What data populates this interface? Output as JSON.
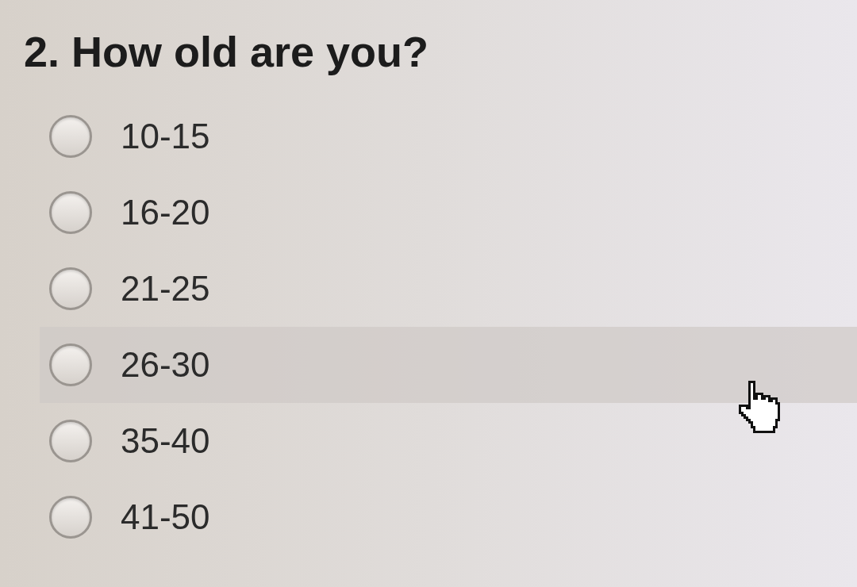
{
  "question": {
    "title": "2. How old are you?",
    "options": [
      {
        "label": "10-15",
        "selected": false,
        "hovered": false
      },
      {
        "label": "16-20",
        "selected": false,
        "hovered": false
      },
      {
        "label": "21-25",
        "selected": false,
        "hovered": false
      },
      {
        "label": "26-30",
        "selected": false,
        "hovered": true
      },
      {
        "label": "35-40",
        "selected": false,
        "hovered": false
      },
      {
        "label": "41-50",
        "selected": false,
        "hovered": false
      }
    ]
  }
}
